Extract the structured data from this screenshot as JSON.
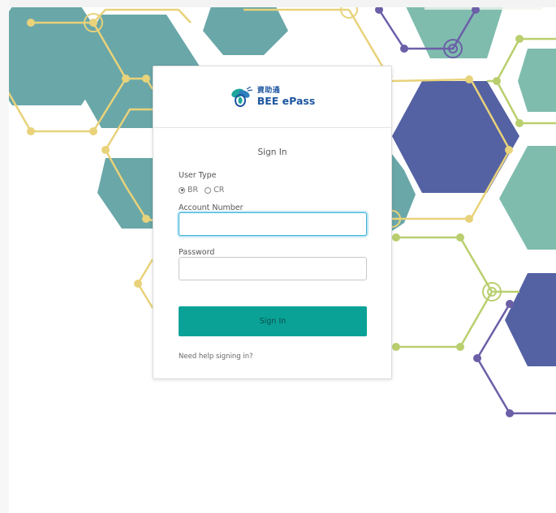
{
  "brand": {
    "name_cn": "資助通",
    "name_en": "BEE ePass"
  },
  "form": {
    "title": "Sign In",
    "user_type_label": "User Type",
    "user_type_options": [
      {
        "label": "BR",
        "selected": true
      },
      {
        "label": "CR",
        "selected": false
      }
    ],
    "account_label": "Account Number",
    "account_value": "",
    "password_label": "Password",
    "password_value": "",
    "submit_label": "Sign In",
    "help_link": "Need help signing in?"
  },
  "colors": {
    "teal_hex": "#6aa7a8",
    "light_teal_hex": "#7fbcae",
    "navy_hex": "#5461a3",
    "yellow_line": "#e8d27a",
    "green_line": "#b9cf6e",
    "purple_line": "#6b5fa8",
    "button": "#0aa297"
  }
}
